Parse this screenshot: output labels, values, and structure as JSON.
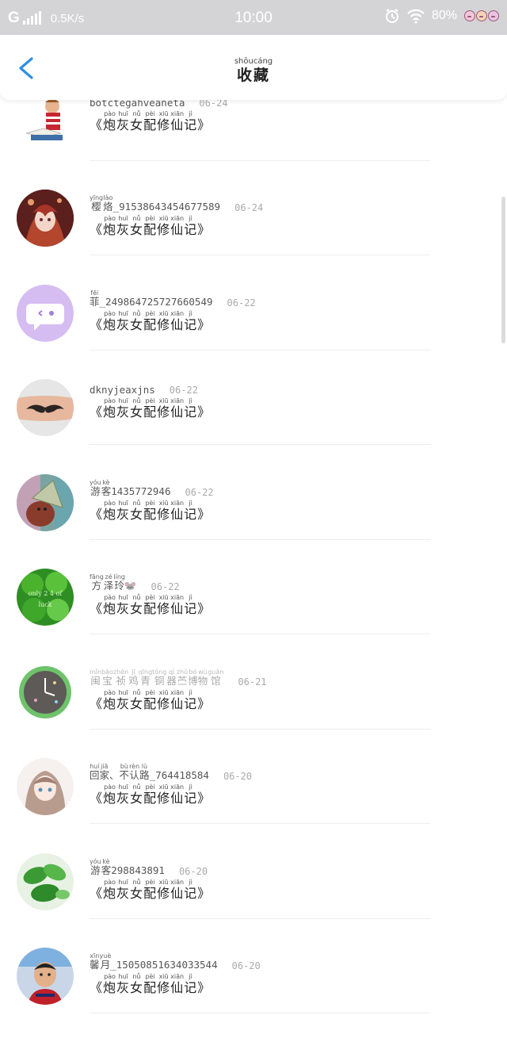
{
  "status_bar": {
    "network": "G",
    "speed": "0.5K/s",
    "time": "10:00",
    "battery": "80%"
  },
  "header": {
    "title_pinyin": "shōucáng",
    "title": "收藏"
  },
  "items": [
    {
      "name_plain": "botctegahveaneta",
      "date": "06-24",
      "book": "《炮灰女配修仙记》"
    },
    {
      "name_pinyin": [
        "yīng",
        "lào"
      ],
      "name_chars": [
        "樱",
        "烙"
      ],
      "name_suffix": "_91538643454677589",
      "date": "06-24",
      "book": "《炮灰女配修仙记》"
    },
    {
      "name_pinyin": [
        "fēi"
      ],
      "name_chars": [
        "菲"
      ],
      "name_suffix": "_249864725727660549",
      "date": "06-22",
      "book": "《炮灰女配修仙记》"
    },
    {
      "name_plain": "dknyjeaxjns",
      "date": "06-22",
      "book": "《炮灰女配修仙记》"
    },
    {
      "name_pinyin": [
        "yóu",
        "kè"
      ],
      "name_chars": [
        "游",
        "客"
      ],
      "name_suffix": "1435772946",
      "date": "06-22",
      "book": "《炮灰女配修仙记》"
    },
    {
      "name_pinyin": [
        "fāng",
        "zé",
        "líng"
      ],
      "name_chars": [
        "方",
        "泽",
        "玲"
      ],
      "name_suffix": "🐭",
      "date": "06-22",
      "book": "《炮灰女配修仙记》"
    },
    {
      "name_pinyin": [
        "mǐn",
        "bǎo",
        "zhēn",
        "jī",
        "qīng",
        "tóng",
        "qì",
        "zhū",
        "bó",
        "wù",
        "guǎn"
      ],
      "name_chars": [
        "闽",
        "宝",
        "祯",
        "鸡",
        "青",
        "铜",
        "器",
        "苎",
        "博",
        "物",
        "馆"
      ],
      "name_suffix": "",
      "date": "06-21",
      "book": "《炮灰女配修仙记》"
    },
    {
      "name_pinyin": [
        "huí",
        "jiā",
        "",
        "bù",
        "rèn",
        "lù"
      ],
      "name_chars": [
        "回",
        "家",
        "、",
        "不",
        "认",
        "路"
      ],
      "name_suffix": "_764418584",
      "date": "06-20",
      "book": "《炮灰女配修仙记》"
    },
    {
      "name_pinyin": [
        "yóu",
        "kè"
      ],
      "name_chars": [
        "游",
        "客"
      ],
      "name_suffix": "298843891",
      "date": "06-20",
      "book": "《炮灰女配修仙记》"
    },
    {
      "name_pinyin": [
        "xīn",
        "yuè"
      ],
      "name_chars": [
        "馨",
        "月"
      ],
      "name_suffix": "_15050851634033544",
      "date": "06-20",
      "book": "《炮灰女配修仙记》"
    }
  ],
  "book_pinyin": [
    "",
    "pào",
    "huī",
    "nǚ",
    "pèi",
    "xiū",
    "xiān",
    "jì",
    ""
  ],
  "book_chars": [
    "《",
    "炮",
    "灰",
    "女",
    "配",
    "修",
    "仙",
    "记",
    "》"
  ],
  "avatars": [
    "reading-child-avatar",
    "anime-girl-avatar",
    "purple-chat-avatar",
    "mustache-finger-avatar",
    "party-hat-avatar",
    "clover-avatar",
    "green-clock-avatar",
    "anime-girl-sketch-avatar",
    "green-leaves-avatar",
    "boy-photo-avatar"
  ]
}
